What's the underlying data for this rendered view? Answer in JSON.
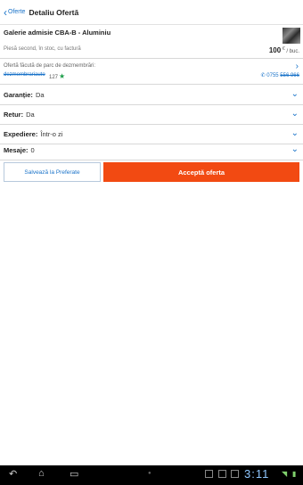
{
  "header": {
    "back_label": "Oferte",
    "back_icon": "chevron-left",
    "title": "Detaliu Ofertă"
  },
  "product": {
    "name": "Galerie admisie CBA-B - Aluminiu",
    "description": "Piesă second, în stoc, cu factură",
    "price_value": "100",
    "price_currency": "€",
    "price_unit": "/ buc."
  },
  "seller": {
    "label": "Ofertă făcută de parc de dezmembrări:",
    "name": "dezmembrariauto",
    "rating": "127",
    "phone_prefix": "0755",
    "phone_masked": "556 966"
  },
  "details": [
    {
      "label": "Garanție:",
      "value": "Da"
    },
    {
      "label": "Retur:",
      "value": "Da"
    },
    {
      "label": "Expediere:",
      "value": "Într-o zi"
    },
    {
      "label": "Mesaje:",
      "value": "0"
    }
  ],
  "actions": {
    "save_label": "Salvează la Preferate",
    "accept_label": "Acceptă oferta"
  },
  "system": {
    "clock": "3:11"
  },
  "colors": {
    "accent": "#1a73c9",
    "accept": "#f24a12",
    "star": "#1e9e4a"
  }
}
